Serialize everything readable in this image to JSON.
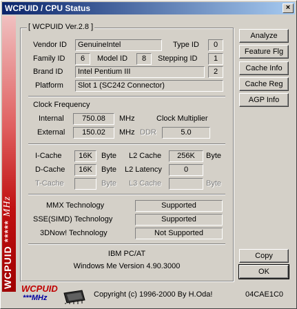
{
  "window": {
    "title": "WCPUID / CPU Status",
    "close_glyph": "×"
  },
  "sidebar": {
    "brand": "WCPUID",
    "stars": "*****",
    "mhz": "MHz"
  },
  "cpuid_group": {
    "title": "[ WCPUID Ver.2.8 ]",
    "vendor_label": "Vendor ID",
    "vendor_value": "GenuineIntel",
    "type_label": "Type ID",
    "type_value": "0",
    "family_label": "Family ID",
    "family_value": "6",
    "model_label": "Model ID",
    "model_value": "8",
    "stepping_label": "Stepping ID",
    "stepping_value": "1",
    "brand_label": "Brand ID",
    "brand_value": "Intel Pentium III",
    "brand_num": "2",
    "platform_label": "Platform",
    "platform_value": "Slot 1 (SC242 Connector)"
  },
  "clock": {
    "title": "Clock Frequency",
    "internal_label": "Internal",
    "internal_value": "750.08",
    "internal_unit": "MHz",
    "multiplier_label": "Clock Multiplier",
    "external_label": "External",
    "external_value": "150.02",
    "external_unit": "MHz",
    "ddr_label": "DDR",
    "multiplier_value": "5.0"
  },
  "cache": {
    "icache_label": "I-Cache",
    "icache_value": "16K",
    "icache_unit": "Byte",
    "l2_label": "L2 Cache",
    "l2_value": "256K",
    "l2_unit": "Byte",
    "dcache_label": "D-Cache",
    "dcache_value": "16K",
    "dcache_unit": "Byte",
    "l2lat_label": "L2 Latency",
    "l2lat_value": "0",
    "tcache_label": "T-Cache",
    "tcache_unit": "Byte",
    "l3_label": "L3 Cache",
    "l3_unit": "Byte"
  },
  "tech": {
    "mmx_label": "MMX Technology",
    "mmx_value": "Supported",
    "sse_label": "SSE(SIMD) Technology",
    "sse_value": "Supported",
    "now_label": "3DNow! Technology",
    "now_value": "Not Supported"
  },
  "system": {
    "machine": "IBM PC/AT",
    "os": "Windows Me  Version 4.90.3000"
  },
  "buttons": {
    "analyze": "Analyze",
    "feature": "Feature Flg",
    "cache_info": "Cache Info",
    "cache_reg": "Cache Reg",
    "agp_info": "AGP Info",
    "copy": "Copy",
    "ok": "OK"
  },
  "footer": {
    "logo_text": "WCPUID",
    "logo_sub": "***MHz",
    "copyright": "Copyright (c) 1996-2000  By H.Oda!",
    "code": "04CAE1C0"
  }
}
